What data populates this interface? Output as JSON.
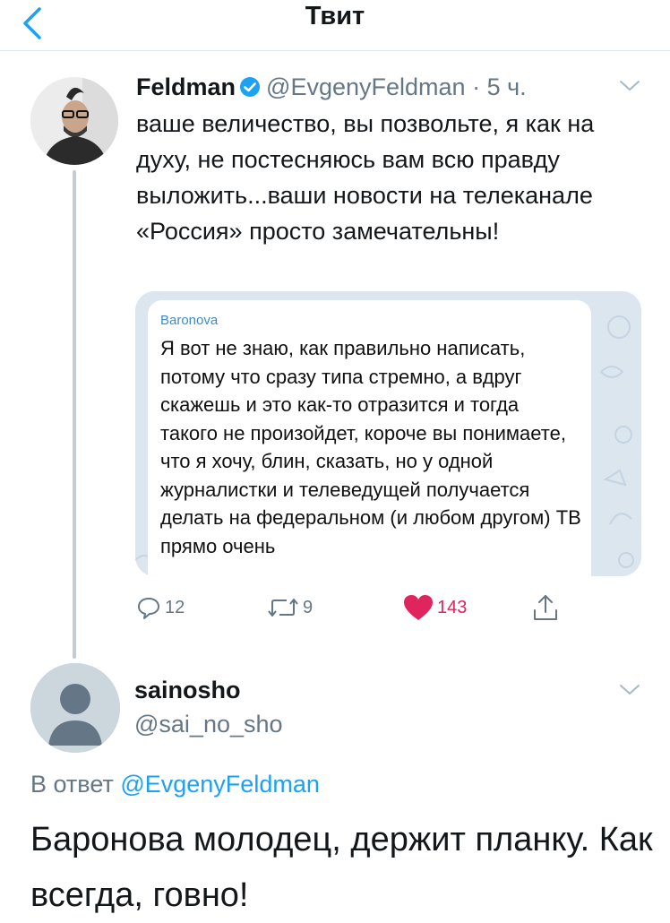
{
  "nav": {
    "title": "Твит"
  },
  "tweet1": {
    "name": "Feldman",
    "handle": "@EvgenyFeldman",
    "separator": "·",
    "time": "5 ч.",
    "text": "ваше величество, вы позвольте, я как на духу, не постесняюсь вам всю правду выложить...ваши новости на телеканале «Россия» просто замечательны!",
    "embed": {
      "sender": "Baronova",
      "text": "Я вот не знаю, как правильно написать, потому что сразу типа стремно, а вдруг скажешь и это как-то отразится и тогда такого не произойдет, короче вы понимаете, что я хочу, блин, сказать, но у одной журналистки и телеведущей получается делать на федеральном (и любом другом) ТВ прямо очень"
    },
    "actions": {
      "replies": "12",
      "retweets": "9",
      "likes": "143"
    }
  },
  "tweet2": {
    "name": "sainosho",
    "handle": "@sai_no_sho",
    "reply_prefix": "В ответ",
    "reply_to": "@EvgenyFeldman",
    "text": "Баронова молодец, держит планку. Как всегда, говно!"
  },
  "colors": {
    "accent": "#1da1f2",
    "like": "#e0245e",
    "secondary_text": "#657786",
    "border": "#e1e8ed",
    "verified_blue": "#1da1f2"
  },
  "icons": [
    "back-chevron-icon",
    "verified-badge-icon",
    "chevron-down-icon",
    "reply-icon",
    "retweet-icon",
    "heart-icon",
    "share-icon",
    "default-avatar-icon"
  ]
}
